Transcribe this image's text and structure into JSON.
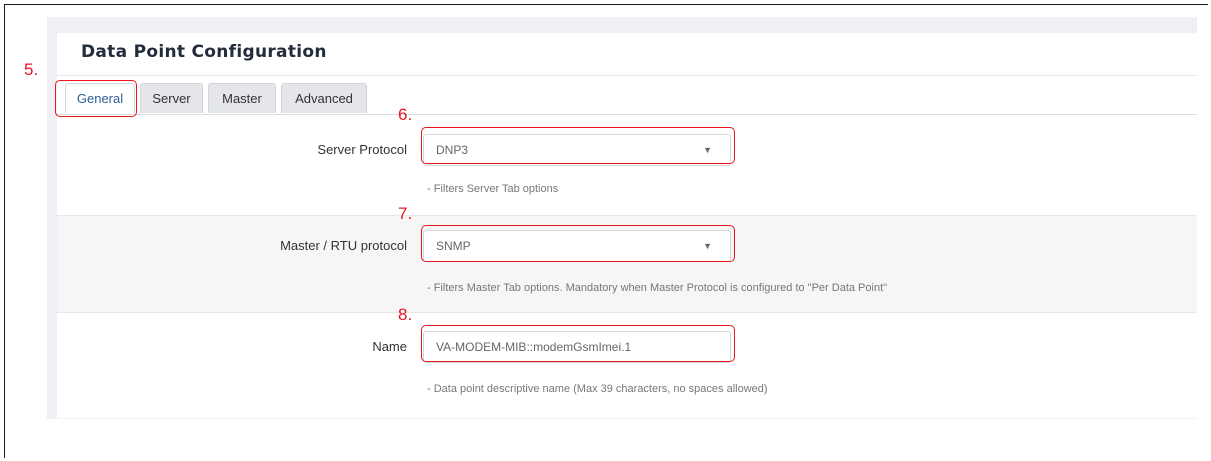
{
  "card": {
    "title": "Data Point Configuration"
  },
  "tabs": [
    {
      "label": "General",
      "active": true
    },
    {
      "label": "Server",
      "active": false
    },
    {
      "label": "Master",
      "active": false
    },
    {
      "label": "Advanced",
      "active": false
    }
  ],
  "fields": {
    "server_protocol": {
      "label": "Server Protocol",
      "value": "DNP3",
      "hint": "- Filters Server Tab options"
    },
    "master_protocol": {
      "label": "Master / RTU protocol",
      "value": "SNMP",
      "hint": "- Filters Master Tab options. Mandatory when Master Protocol is configured to \"Per Data Point\""
    },
    "name": {
      "label": "Name",
      "value": "VA-MODEM-MIB::modemGsmImei.1",
      "hint": "- Data point descriptive name (Max 39 characters, no spaces allowed)"
    }
  },
  "annotations": {
    "step5": "5.",
    "step6": "6.",
    "step7": "7.",
    "step8": "8."
  },
  "icons": {
    "dropdown": "chevron-down-icon"
  },
  "colors": {
    "annotation": "#e8171f",
    "active_tab_text": "#2f5d96",
    "title": "#222c3a"
  }
}
